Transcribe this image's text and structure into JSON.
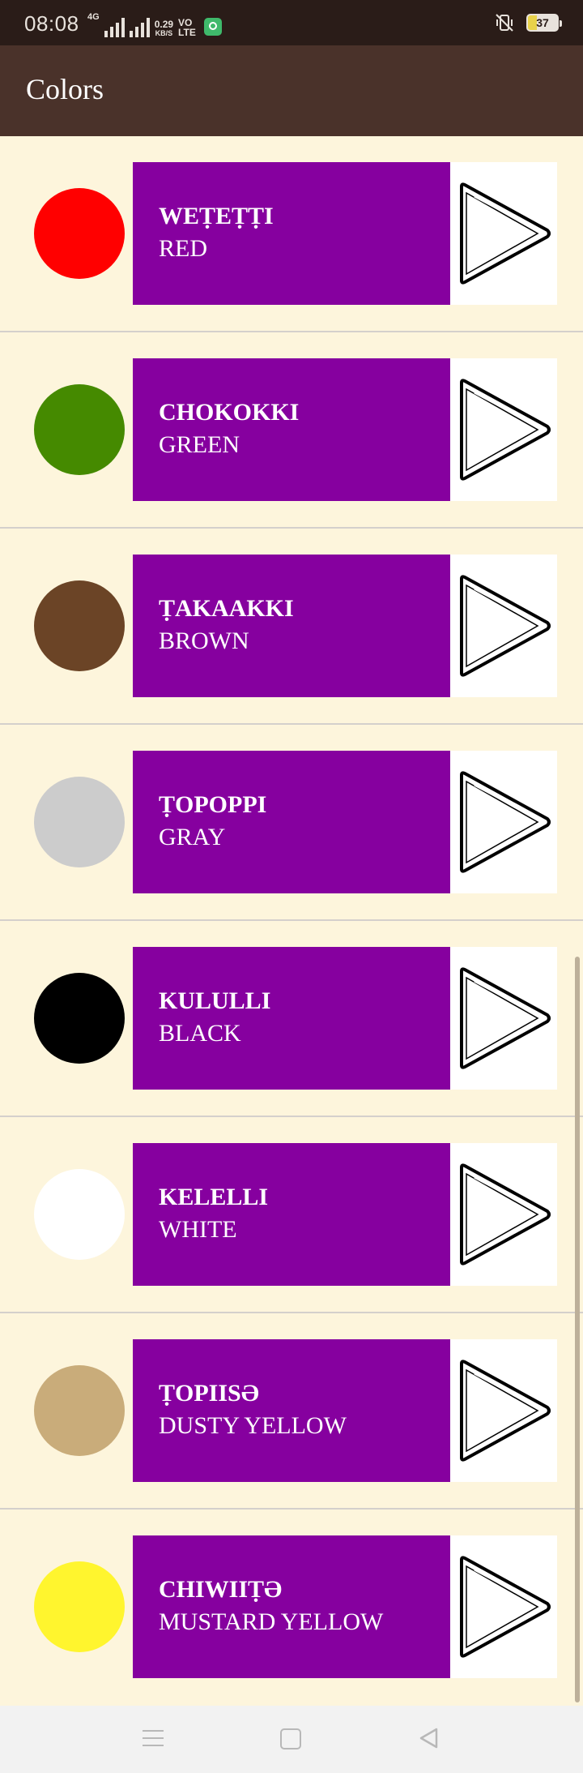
{
  "status_bar": {
    "time": "08:08",
    "network_type": "4G",
    "net_speed_value": "0.29",
    "net_speed_unit": "KB/S",
    "volte_top": "VO",
    "volte_bottom": "LTE",
    "battery_level": "37",
    "icons": [
      "signal-icon",
      "app-notification-icon",
      "vibrate-mute-icon",
      "battery-icon"
    ]
  },
  "app_bar": {
    "title": "Colors"
  },
  "colors": [
    {
      "native": "WEṬEṬṬI",
      "english": "RED",
      "swatch": "#ff0000"
    },
    {
      "native": "CHOKOKKI",
      "english": "GREEN",
      "swatch": "#458a00"
    },
    {
      "native": "ṬAKAAKKI",
      "english": "BROWN",
      "swatch": "#6b4426"
    },
    {
      "native": "ṬOPOPPI",
      "english": "GRAY",
      "swatch": "#cccccc"
    },
    {
      "native": "KULULLI",
      "english": "BLACK",
      "swatch": "#000000"
    },
    {
      "native": "KELELLI",
      "english": "WHITE",
      "swatch": "#ffffff"
    },
    {
      "native": "ṬOPIISƏ",
      "english": "DUSTY YELLOW",
      "swatch": "#c9ac7a"
    },
    {
      "native": "CHIWIIṬƏ",
      "english": "MUSTARD YELLOW",
      "swatch": "#fff52e"
    }
  ],
  "theme": {
    "label_bg": "#86009f",
    "app_bar_bg": "#4a322a",
    "list_bg": "#fdf5dc",
    "play_icon": "play-icon"
  },
  "nav_bar": {
    "icons": [
      "menu-icon",
      "home-icon",
      "back-icon"
    ]
  }
}
